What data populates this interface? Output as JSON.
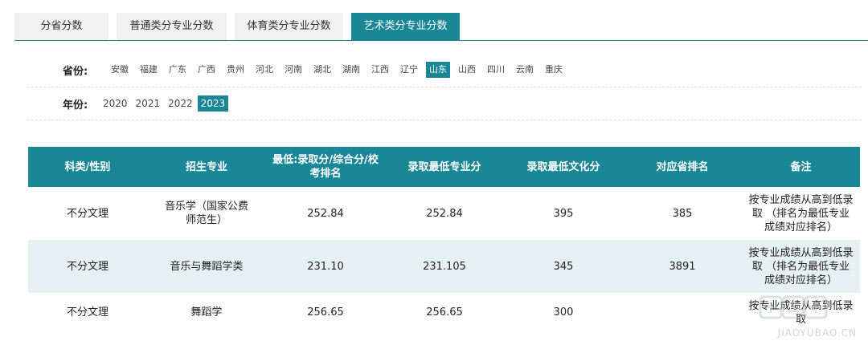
{
  "tabs": [
    {
      "label": "分省分数",
      "active": false
    },
    {
      "label": "普通类分专业分数",
      "active": false
    },
    {
      "label": "体育类分专业分数",
      "active": false
    },
    {
      "label": "艺术类分专业分数",
      "active": true
    }
  ],
  "filters": {
    "province": {
      "label": "省份:",
      "options": [
        "安徽",
        "福建",
        "广东",
        "广西",
        "贵州",
        "河北",
        "河南",
        "湖北",
        "湖南",
        "江西",
        "辽宁",
        "山东",
        "山西",
        "四川",
        "云南",
        "重庆"
      ],
      "selected": "山东"
    },
    "year": {
      "label": "年份:",
      "options": [
        "2020",
        "2021",
        "2022",
        "2023"
      ],
      "selected": "2023"
    }
  },
  "table": {
    "headers": [
      "科类/性别",
      "招生专业",
      "最低:录取分/综合分/校考排名",
      "录取最低专业分",
      "录取最低文化分",
      "对应省排名",
      "备注"
    ],
    "rows": [
      [
        "不分文理",
        "音乐学（国家公费师范生）",
        "252.84",
        "252.84",
        "395",
        "385",
        "按专业成绩从高到低录取 （排名为最低专业成绩对应排名）"
      ],
      [
        "不分文理",
        "音乐与舞蹈学类",
        "231.10",
        "231.105",
        "345",
        "3891",
        "按专业成绩从高到低录取 （排名为最低专业成绩对应排名）"
      ],
      [
        "不分文理",
        "舞蹈学",
        "256.65",
        "256.65",
        "300",
        "",
        "按专业成绩从高到低录取"
      ]
    ]
  },
  "watermark": {
    "text": "JIAOYUBAO.CN"
  },
  "colors": {
    "accent": "#1a8797",
    "alt_row": "#e7f0f2"
  }
}
